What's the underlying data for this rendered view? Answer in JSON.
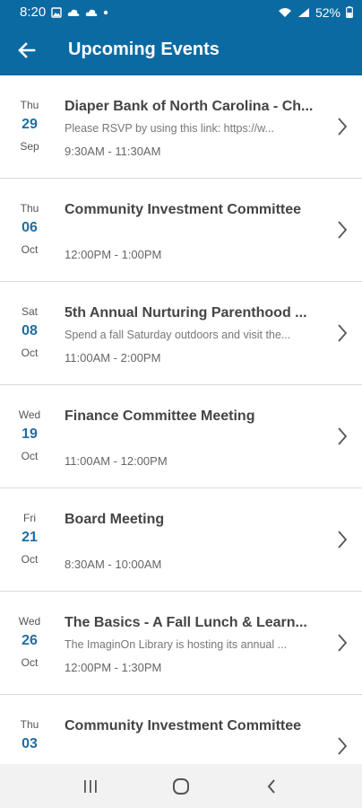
{
  "status_bar": {
    "time": "8:20",
    "battery": "52%",
    "icons": [
      "image-icon",
      "cloud-icon",
      "cloud-icon",
      "dot-icon",
      "wifi-icon",
      "signal-icon",
      "battery-icon"
    ]
  },
  "app_bar": {
    "title": "Upcoming Events",
    "back_icon": "arrow-left-icon"
  },
  "events": [
    {
      "dow": "Thu",
      "day": "29",
      "month": "Sep",
      "title": "Diaper Bank of North Carolina - Ch...",
      "description": "Please RSVP by using this link:      https://w...",
      "time": "9:30AM - 11:30AM"
    },
    {
      "dow": "Thu",
      "day": "06",
      "month": "Oct",
      "title": "Community Investment Committee",
      "description": "",
      "time": "12:00PM - 1:00PM"
    },
    {
      "dow": "Sat",
      "day": "08",
      "month": "Oct",
      "title": "5th Annual Nurturing Parenthood ...",
      "description": "Spend a fall Saturday outdoors and visit the...",
      "time": "11:00AM - 2:00PM"
    },
    {
      "dow": "Wed",
      "day": "19",
      "month": "Oct",
      "title": "Finance Committee Meeting",
      "description": "",
      "time": "11:00AM - 12:00PM"
    },
    {
      "dow": "Fri",
      "day": "21",
      "month": "Oct",
      "title": "Board Meeting",
      "description": "",
      "time": "8:30AM - 10:00AM"
    },
    {
      "dow": "Wed",
      "day": "26",
      "month": "Oct",
      "title": "The Basics - A Fall Lunch & Learn...",
      "description": "The ImaginOn Library is hosting its annual ...",
      "time": "12:00PM - 1:30PM"
    },
    {
      "dow": "Thu",
      "day": "03",
      "month": "",
      "title": "Community Investment Committee",
      "description": "",
      "time": ""
    }
  ],
  "nav_bar": {
    "icons": [
      "recent-apps-icon",
      "home-icon",
      "back-icon"
    ]
  },
  "colors": {
    "primary": "#0b6aa2",
    "date_accent": "#1f6ea3"
  }
}
